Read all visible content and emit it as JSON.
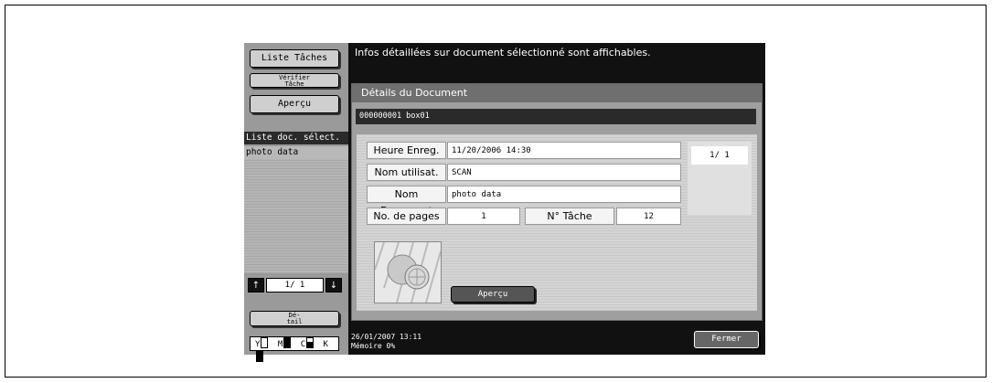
{
  "left": {
    "job_list_button": "Liste Tâches",
    "verify_job_line1": "Vérifier",
    "verify_job_line2": "Tâche",
    "preview_button": "Aperçu",
    "list_header": "Liste doc. sélect.",
    "list_items": [
      "photo data"
    ],
    "pager": "1/ 1",
    "detail_line1": "Dé-",
    "detail_line2": "tail",
    "toner_labels": [
      "Y",
      "M",
      "C",
      "K"
    ]
  },
  "message": "Infos détaillées sur document sélectionné sont affichables.",
  "panel": {
    "title": "Détails du Document",
    "box_info": "000000001   box01",
    "fields": {
      "saved_time_label": "Heure Enreg.",
      "saved_time_value": "11/20/2006 14:30",
      "user_label": "Nom utilisat.",
      "user_value": "SCAN",
      "doc_name_label": "Nom Document",
      "doc_name_value": "photo data",
      "pages_label": "No. de pages",
      "pages_value": "1",
      "job_no_label": "N° Tâche",
      "job_no_value": "12"
    },
    "page_count": "1/  1",
    "preview_button": "Aperçu"
  },
  "status": {
    "datetime": "26/01/2007    13:11",
    "memory": "Mémoire         0%"
  },
  "close_button": "Fermer"
}
